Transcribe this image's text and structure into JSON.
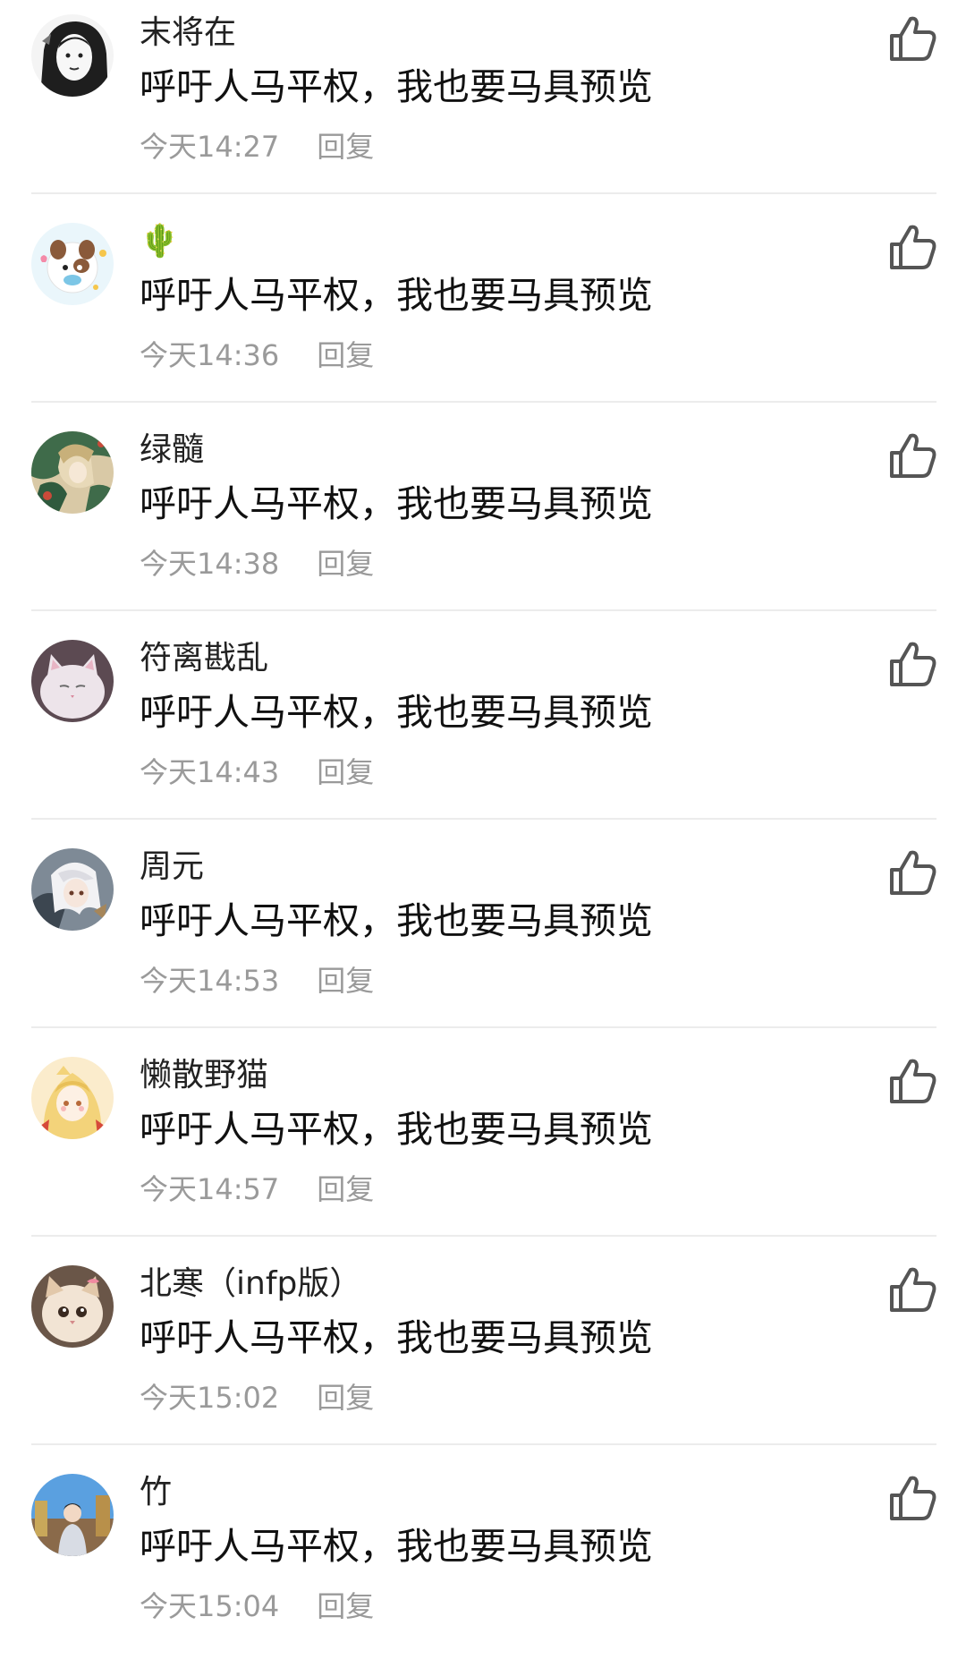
{
  "comments": [
    {
      "username": "末将在",
      "text": "呼吁人马平权，我也要马具预览",
      "time": "今天14:27",
      "reply_label": "回复",
      "avatar_icon": "avatar-ink-portrait"
    },
    {
      "username": "🌵",
      "text": "呼吁人马平权，我也要马具预览",
      "time": "今天14:36",
      "reply_label": "回复",
      "avatar_icon": "avatar-cartoon-animal"
    },
    {
      "username": "绿髓",
      "text": "呼吁人马平权，我也要马具预览",
      "time": "今天14:38",
      "reply_label": "回复",
      "avatar_icon": "avatar-anime-character"
    },
    {
      "username": "符离戡乱",
      "text": "呼吁人马平权，我也要马具预览",
      "time": "今天14:43",
      "reply_label": "回复",
      "avatar_icon": "avatar-white-cat"
    },
    {
      "username": "周元",
      "text": "呼吁人马平权，我也要马具预览",
      "time": "今天14:53",
      "reply_label": "回复",
      "avatar_icon": "avatar-anime-white-hair"
    },
    {
      "username": "懒散野猫",
      "text": "呼吁人马平权，我也要马具预览",
      "time": "今天14:57",
      "reply_label": "回复",
      "avatar_icon": "avatar-anime-blonde-girl"
    },
    {
      "username": "北寒（infp版）",
      "text": "呼吁人马平权，我也要马具预览",
      "time": "今天15:02",
      "reply_label": "回复",
      "avatar_icon": "avatar-fluffy-cat"
    },
    {
      "username": "竹",
      "text": "呼吁人马平权，我也要马具预览",
      "time": "今天15:04",
      "reply_label": "回复",
      "avatar_icon": "avatar-photo-person"
    }
  ],
  "icons": {
    "like": "thumbs-up-icon"
  },
  "colors": {
    "secondary_text": "#9a9a9a",
    "divider": "#ececec",
    "icon_stroke": "#555555"
  }
}
